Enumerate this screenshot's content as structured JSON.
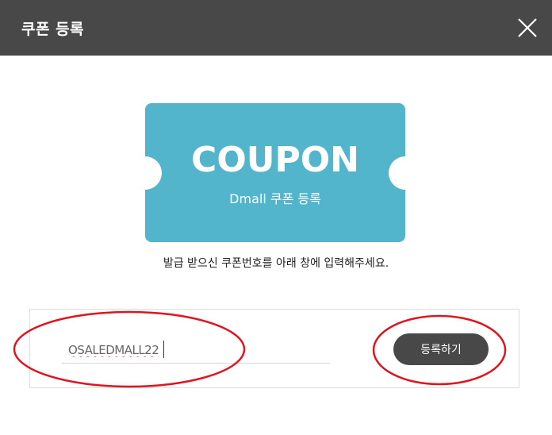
{
  "header": {
    "title": "쿠폰 등록"
  },
  "coupon_card": {
    "title": "COUPON",
    "subtitle": "Dmall 쿠폰 등록",
    "color": "#52b5cc"
  },
  "instruction": "발급 받으신 쿠폰번호를 아래 창에 입력해주세요.",
  "form": {
    "code_value": "OSALEDMALL22",
    "register_label": "등록하기"
  },
  "colors": {
    "header_bg": "#484848",
    "button_bg": "#484848",
    "annotation": "#e0141e"
  },
  "icons": {
    "close": "close-icon"
  }
}
